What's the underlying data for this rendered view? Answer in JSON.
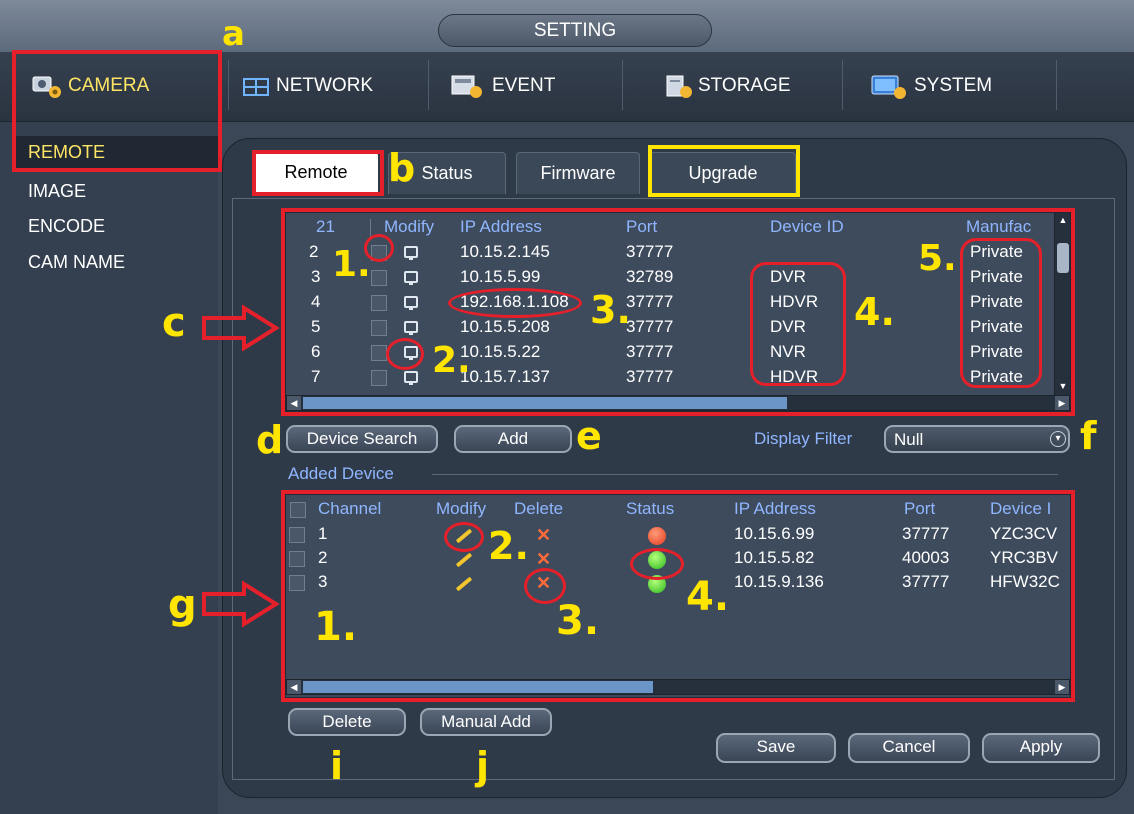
{
  "header": {
    "title": "SETTING"
  },
  "menu": [
    {
      "label": "CAMERA",
      "icon": "camera-icon",
      "active": true
    },
    {
      "label": "NETWORK",
      "icon": "network-icon"
    },
    {
      "label": "EVENT",
      "icon": "event-icon"
    },
    {
      "label": "STORAGE",
      "icon": "storage-icon"
    },
    {
      "label": "SYSTEM",
      "icon": "system-icon"
    }
  ],
  "sidebar": {
    "items": [
      "REMOTE",
      "IMAGE",
      "ENCODE",
      "CAM NAME"
    ],
    "active_index": 0
  },
  "tabs": [
    "Remote",
    "Status",
    "Firmware",
    "Upgrade"
  ],
  "search_table": {
    "count": "21",
    "headers": [
      "Modify",
      "IP Address",
      "Port",
      "Device ID",
      "Manufac"
    ],
    "rows": [
      {
        "no": "2",
        "ip": "10.15.2.145",
        "port": "37777",
        "device_id": "",
        "manufacturer": "Private"
      },
      {
        "no": "3",
        "ip": "10.15.5.99",
        "port": "32789",
        "device_id": "DVR",
        "manufacturer": "Private"
      },
      {
        "no": "4",
        "ip": "192.168.1.108",
        "port": "37777",
        "device_id": "HDVR",
        "manufacturer": "Private"
      },
      {
        "no": "5",
        "ip": "10.15.5.208",
        "port": "37777",
        "device_id": "DVR",
        "manufacturer": "Private"
      },
      {
        "no": "6",
        "ip": "10.15.5.22",
        "port": "37777",
        "device_id": "NVR",
        "manufacturer": "Private"
      },
      {
        "no": "7",
        "ip": "10.15.7.137",
        "port": "37777",
        "device_id": "HDVR",
        "manufacturer": "Private"
      }
    ]
  },
  "search_controls": {
    "device_search": "Device Search",
    "add": "Add",
    "filter_label": "Display Filter",
    "filter_value": "Null"
  },
  "added_device": {
    "label": "Added Device",
    "headers": [
      "Channel",
      "Modify",
      "Delete",
      "Status",
      "IP Address",
      "Port",
      "Device I"
    ],
    "rows": [
      {
        "channel": "1",
        "status": "offline",
        "ip": "10.15.6.99",
        "port": "37777",
        "device_id": "YZC3CV"
      },
      {
        "channel": "2",
        "status": "online",
        "ip": "10.15.5.82",
        "port": "40003",
        "device_id": "YRC3BV"
      },
      {
        "channel": "3",
        "status": "online",
        "ip": "10.15.9.136",
        "port": "37777",
        "device_id": "HFW32C"
      }
    ],
    "status_colors": {
      "online": "#29b81c",
      "offline": "#e23a1c"
    }
  },
  "buttons": {
    "delete": "Delete",
    "manual_add": "Manual Add",
    "save": "Save",
    "cancel": "Cancel",
    "apply": "Apply"
  },
  "annotations": {
    "a": "a",
    "b": "b",
    "c": "c",
    "d": "d",
    "e": "e",
    "f": "f",
    "g": "g",
    "i": "i",
    "j": "j",
    "n1": "1.",
    "n2": "2.",
    "n3": "3.",
    "n4": "4.",
    "n5": "5."
  },
  "colors": {
    "highlight_red": "#e5202a",
    "annotation_yellow": "#ffe500",
    "header_blue": "#8fb6ff"
  }
}
